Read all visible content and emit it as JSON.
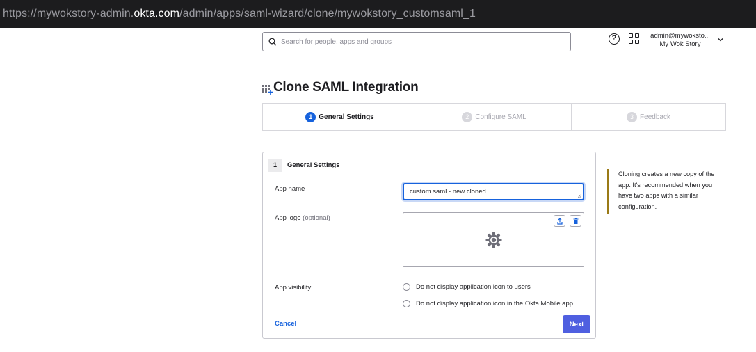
{
  "browser": {
    "url_prefix": "https://mywokstory-admin.",
    "url_domain": "okta.com",
    "url_suffix": "/admin/apps/saml-wizard/clone/mywokstory_customsaml_1"
  },
  "header": {
    "search_placeholder": "Search for people, apps and groups",
    "help_label": "?",
    "user_email": "admin@mywoksto...",
    "user_org": "My Wok Story"
  },
  "page": {
    "title": "Clone SAML Integration"
  },
  "steps": [
    {
      "num": "1",
      "label": "General Settings",
      "active": true
    },
    {
      "num": "2",
      "label": "Configure SAML",
      "active": false
    },
    {
      "num": "3",
      "label": "Feedback",
      "active": false
    }
  ],
  "form": {
    "section_num": "1",
    "section_title": "General Settings",
    "app_name_label": "App name",
    "app_name_value": "custom saml - new cloned",
    "app_logo_label": "App logo",
    "app_logo_optional": "(optional)",
    "app_visibility_label": "App visibility",
    "visibility_options": [
      "Do not display application icon to users",
      "Do not display application icon in the Okta Mobile app"
    ],
    "cancel_label": "Cancel",
    "next_label": "Next"
  },
  "note": {
    "text": "Cloning creates a new copy of the app. It's recommended when you have two apps with a similar configuration."
  },
  "colors": {
    "accent": "#1662dd",
    "primary_button": "#4f5fe0",
    "note_border": "#9a7a16"
  }
}
